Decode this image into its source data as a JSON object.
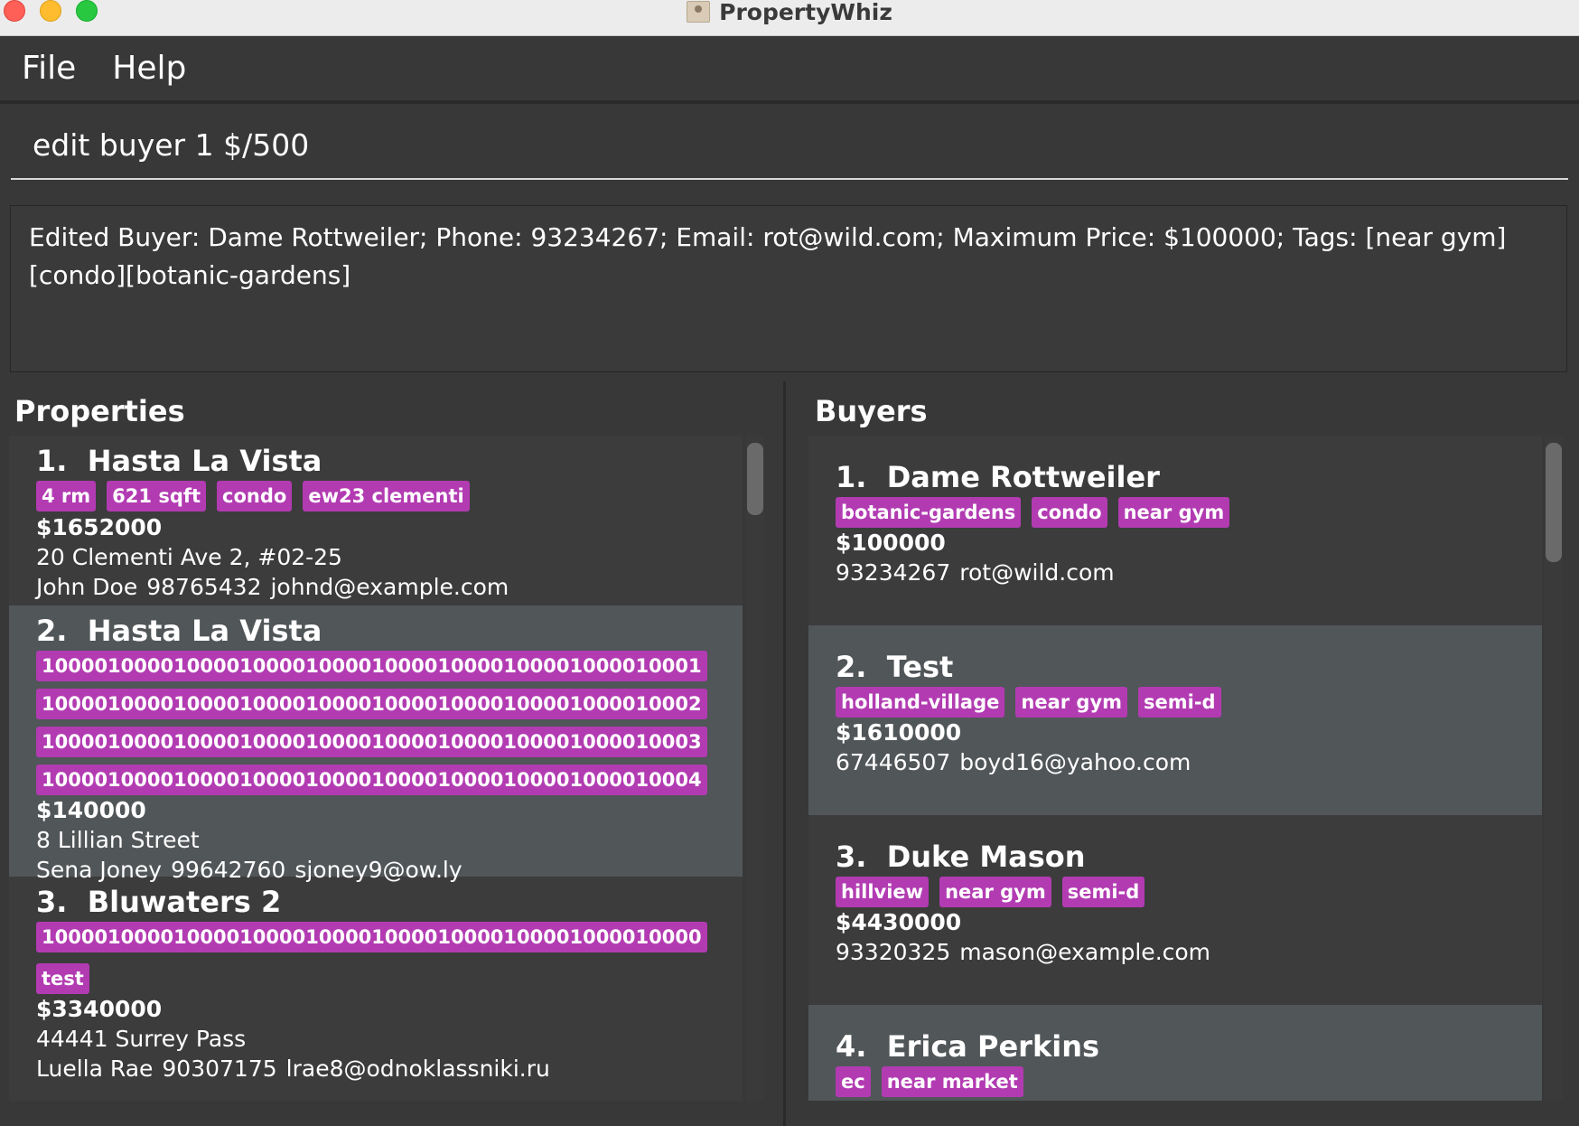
{
  "window": {
    "title": "PropertyWhiz"
  },
  "menu": {
    "file": "File",
    "help": "Help"
  },
  "command": {
    "value": "edit buyer 1 $/500"
  },
  "result": {
    "text": "Edited Buyer: Dame Rottweiler; Phone: 93234267; Email: rot@wild.com; Maximum Price: $100000; Tags: [near gym][condo][botanic-gardens]"
  },
  "properties": {
    "title": "Properties",
    "items": [
      {
        "index": "1.",
        "name": "Hasta La Vista",
        "tags": [
          "4 rm",
          "621 sqft",
          "condo",
          "ew23 clementi"
        ],
        "price": "$1652000",
        "address": "20 Clementi Ave 2, #02-25",
        "owner": "John Doe",
        "phone": "98765432",
        "email": "johnd@example.com"
      },
      {
        "index": "2.",
        "name": "Hasta La Vista",
        "tags": [
          "10000100001000010000100001000010000100001000010001",
          "10000100001000010000100001000010000100001000010002",
          "10000100001000010000100001000010000100001000010003",
          "10000100001000010000100001000010000100001000010004"
        ],
        "price": "$140000",
        "address": "8 Lillian Street",
        "owner": "Sena Joney",
        "phone": "99642760",
        "email": "sjoney9@ow.ly"
      },
      {
        "index": "3.",
        "name": "Bluwaters 2",
        "tags": [
          "10000100001000010000100001000010000100001000010000",
          "test"
        ],
        "price": "$3340000",
        "address": "44441 Surrey Pass",
        "owner": "Luella Rae",
        "phone": "90307175",
        "email": "lrae8@odnoklassniki.ru"
      }
    ]
  },
  "buyers": {
    "title": "Buyers",
    "items": [
      {
        "index": "1.",
        "name": "Dame Rottweiler",
        "tags": [
          "botanic-gardens",
          "condo",
          "near gym"
        ],
        "price": "$100000",
        "phone": "93234267",
        "email": "rot@wild.com"
      },
      {
        "index": "2.",
        "name": "Test",
        "tags": [
          "holland-village",
          "near gym",
          "semi-d"
        ],
        "price": "$1610000",
        "phone": "67446507",
        "email": "boyd16@yahoo.com"
      },
      {
        "index": "3.",
        "name": "Duke Mason",
        "tags": [
          "hillview",
          "near gym",
          "semi-d"
        ],
        "price": "$4430000",
        "phone": "93320325",
        "email": "mason@example.com"
      },
      {
        "index": "4.",
        "name": "Erica Perkins",
        "tags": [
          "ec",
          "near market"
        ]
      }
    ]
  },
  "colors": {
    "tag": "#b23bb2",
    "background": "#383838",
    "card_dark": "#3c3c3c",
    "card_light": "#515658"
  }
}
